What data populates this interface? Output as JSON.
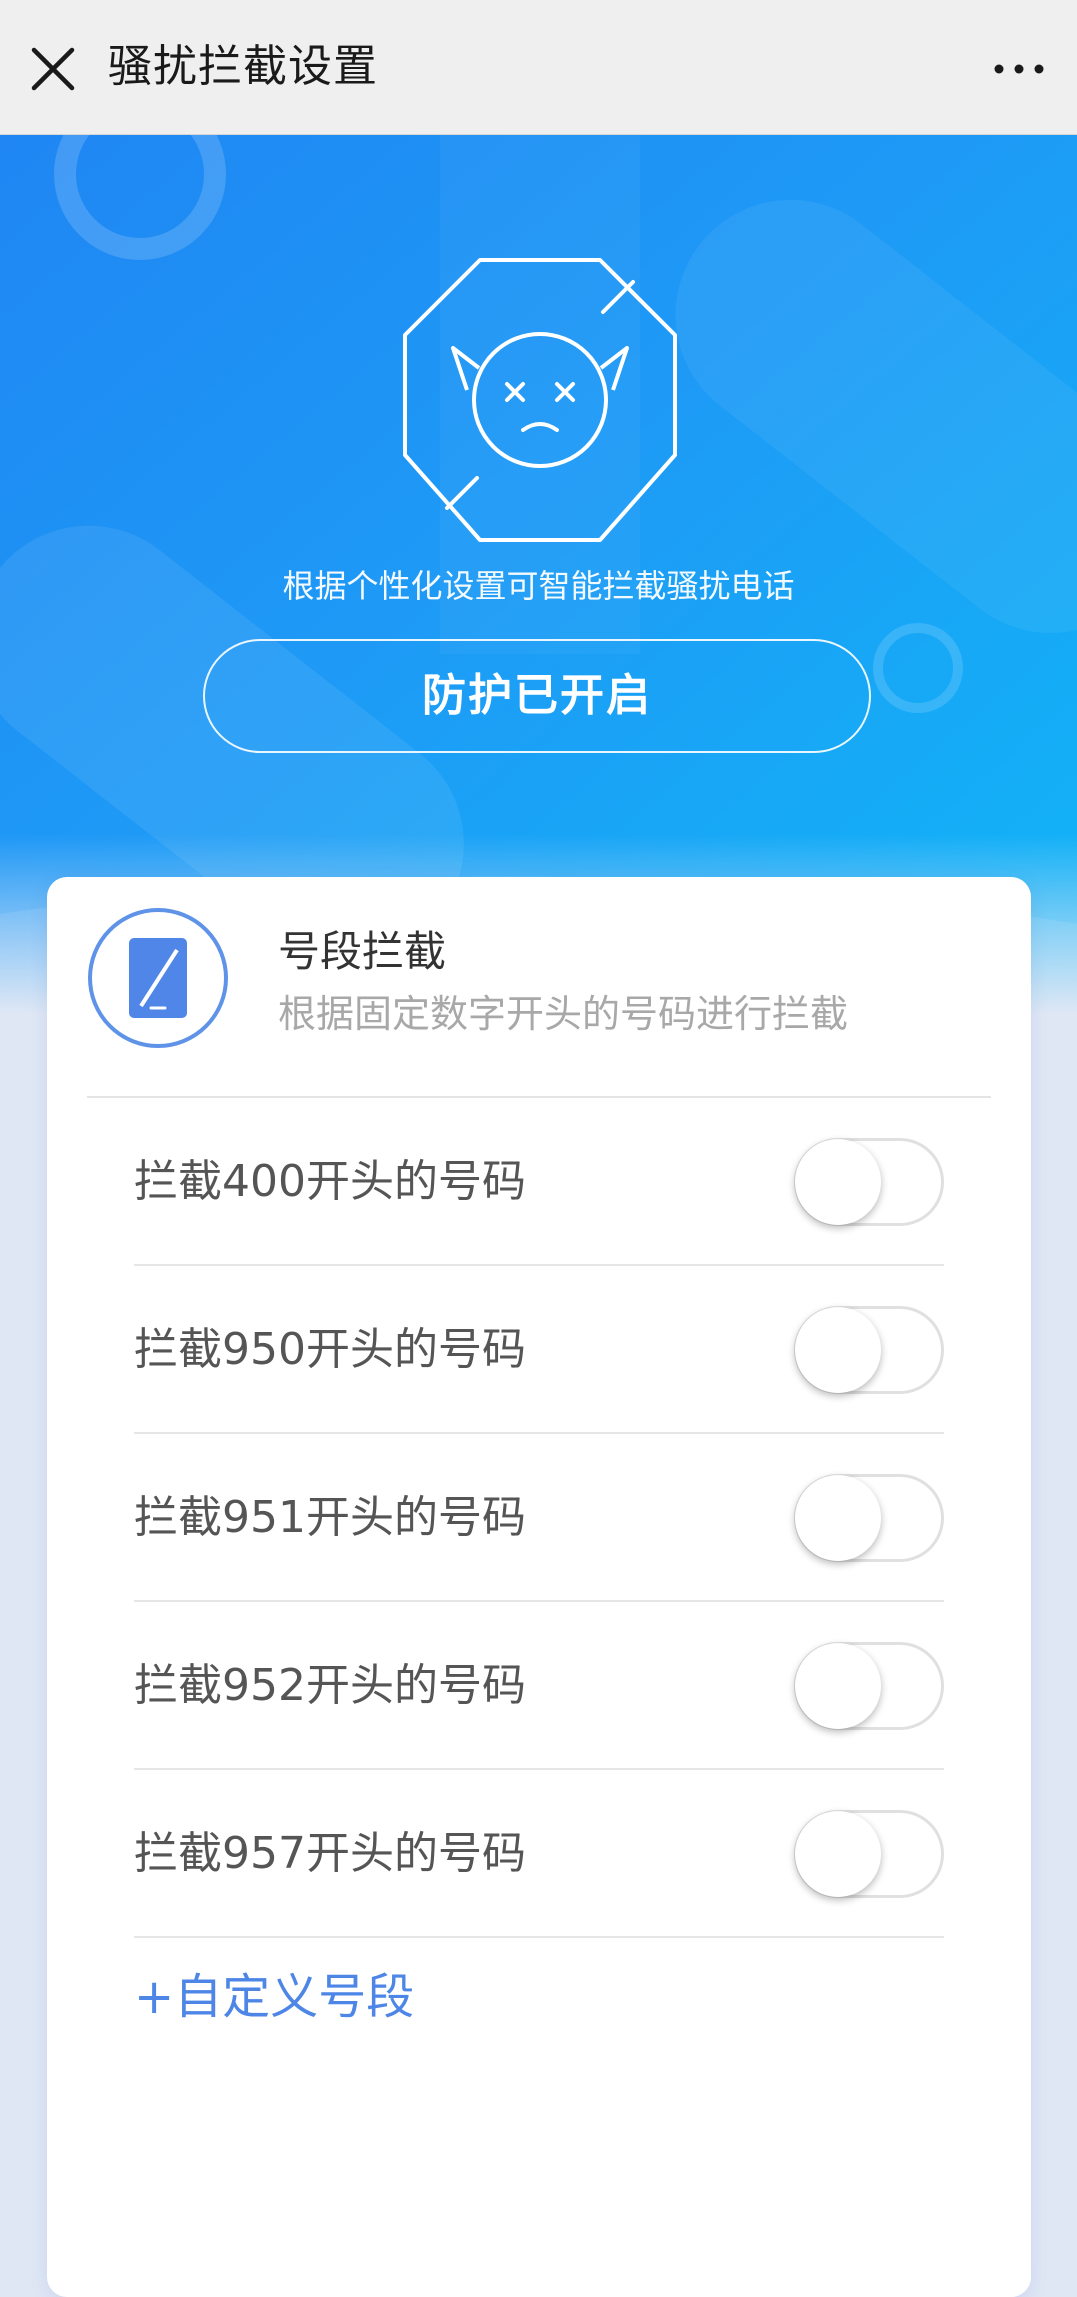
{
  "topbar": {
    "title": "骚扰拦截设置",
    "close_icon": "close-icon",
    "more_icon": "more-dots-icon"
  },
  "hero": {
    "emblem_icon": "blocked-devil-icon",
    "tagline": "根据个性化设置可智能拦截骚扰电话",
    "status_label": "防护已开启"
  },
  "card": {
    "icon": "phone-icon",
    "title": "号段拦截",
    "subtitle": "根据固定数字开头的号码进行拦截",
    "rows": [
      {
        "label": "拦截400开头的号码",
        "enabled": false
      },
      {
        "label": "拦截950开头的号码",
        "enabled": false
      },
      {
        "label": "拦截951开头的号码",
        "enabled": false
      },
      {
        "label": "拦截952开头的号码",
        "enabled": false
      },
      {
        "label": "拦截957开头的号码",
        "enabled": false
      }
    ],
    "custom_link": "+自定义号段"
  },
  "colors": {
    "hero_start": "#1f86f3",
    "hero_end": "#10b6f7",
    "accent": "#4d86e6"
  }
}
